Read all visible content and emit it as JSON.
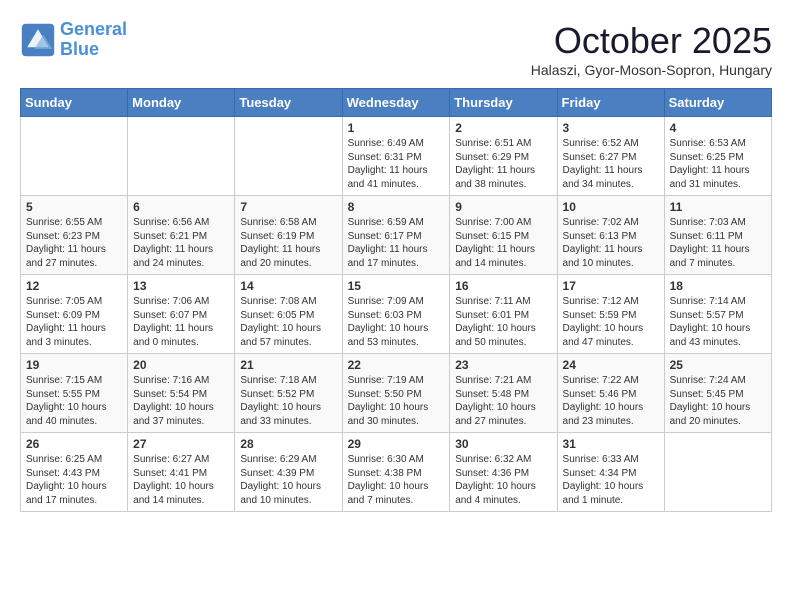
{
  "logo": {
    "line1": "General",
    "line2": "Blue"
  },
  "title": "October 2025",
  "subtitle": "Halaszi, Gyor-Moson-Sopron, Hungary",
  "days_of_week": [
    "Sunday",
    "Monday",
    "Tuesday",
    "Wednesday",
    "Thursday",
    "Friday",
    "Saturday"
  ],
  "weeks": [
    [
      {
        "day": "",
        "info": ""
      },
      {
        "day": "",
        "info": ""
      },
      {
        "day": "",
        "info": ""
      },
      {
        "day": "1",
        "info": "Sunrise: 6:49 AM\nSunset: 6:31 PM\nDaylight: 11 hours and 41 minutes."
      },
      {
        "day": "2",
        "info": "Sunrise: 6:51 AM\nSunset: 6:29 PM\nDaylight: 11 hours and 38 minutes."
      },
      {
        "day": "3",
        "info": "Sunrise: 6:52 AM\nSunset: 6:27 PM\nDaylight: 11 hours and 34 minutes."
      },
      {
        "day": "4",
        "info": "Sunrise: 6:53 AM\nSunset: 6:25 PM\nDaylight: 11 hours and 31 minutes."
      }
    ],
    [
      {
        "day": "5",
        "info": "Sunrise: 6:55 AM\nSunset: 6:23 PM\nDaylight: 11 hours and 27 minutes."
      },
      {
        "day": "6",
        "info": "Sunrise: 6:56 AM\nSunset: 6:21 PM\nDaylight: 11 hours and 24 minutes."
      },
      {
        "day": "7",
        "info": "Sunrise: 6:58 AM\nSunset: 6:19 PM\nDaylight: 11 hours and 20 minutes."
      },
      {
        "day": "8",
        "info": "Sunrise: 6:59 AM\nSunset: 6:17 PM\nDaylight: 11 hours and 17 minutes."
      },
      {
        "day": "9",
        "info": "Sunrise: 7:00 AM\nSunset: 6:15 PM\nDaylight: 11 hours and 14 minutes."
      },
      {
        "day": "10",
        "info": "Sunrise: 7:02 AM\nSunset: 6:13 PM\nDaylight: 11 hours and 10 minutes."
      },
      {
        "day": "11",
        "info": "Sunrise: 7:03 AM\nSunset: 6:11 PM\nDaylight: 11 hours and 7 minutes."
      }
    ],
    [
      {
        "day": "12",
        "info": "Sunrise: 7:05 AM\nSunset: 6:09 PM\nDaylight: 11 hours and 3 minutes."
      },
      {
        "day": "13",
        "info": "Sunrise: 7:06 AM\nSunset: 6:07 PM\nDaylight: 11 hours and 0 minutes."
      },
      {
        "day": "14",
        "info": "Sunrise: 7:08 AM\nSunset: 6:05 PM\nDaylight: 10 hours and 57 minutes."
      },
      {
        "day": "15",
        "info": "Sunrise: 7:09 AM\nSunset: 6:03 PM\nDaylight: 10 hours and 53 minutes."
      },
      {
        "day": "16",
        "info": "Sunrise: 7:11 AM\nSunset: 6:01 PM\nDaylight: 10 hours and 50 minutes."
      },
      {
        "day": "17",
        "info": "Sunrise: 7:12 AM\nSunset: 5:59 PM\nDaylight: 10 hours and 47 minutes."
      },
      {
        "day": "18",
        "info": "Sunrise: 7:14 AM\nSunset: 5:57 PM\nDaylight: 10 hours and 43 minutes."
      }
    ],
    [
      {
        "day": "19",
        "info": "Sunrise: 7:15 AM\nSunset: 5:55 PM\nDaylight: 10 hours and 40 minutes."
      },
      {
        "day": "20",
        "info": "Sunrise: 7:16 AM\nSunset: 5:54 PM\nDaylight: 10 hours and 37 minutes."
      },
      {
        "day": "21",
        "info": "Sunrise: 7:18 AM\nSunset: 5:52 PM\nDaylight: 10 hours and 33 minutes."
      },
      {
        "day": "22",
        "info": "Sunrise: 7:19 AM\nSunset: 5:50 PM\nDaylight: 10 hours and 30 minutes."
      },
      {
        "day": "23",
        "info": "Sunrise: 7:21 AM\nSunset: 5:48 PM\nDaylight: 10 hours and 27 minutes."
      },
      {
        "day": "24",
        "info": "Sunrise: 7:22 AM\nSunset: 5:46 PM\nDaylight: 10 hours and 23 minutes."
      },
      {
        "day": "25",
        "info": "Sunrise: 7:24 AM\nSunset: 5:45 PM\nDaylight: 10 hours and 20 minutes."
      }
    ],
    [
      {
        "day": "26",
        "info": "Sunrise: 6:25 AM\nSunset: 4:43 PM\nDaylight: 10 hours and 17 minutes."
      },
      {
        "day": "27",
        "info": "Sunrise: 6:27 AM\nSunset: 4:41 PM\nDaylight: 10 hours and 14 minutes."
      },
      {
        "day": "28",
        "info": "Sunrise: 6:29 AM\nSunset: 4:39 PM\nDaylight: 10 hours and 10 minutes."
      },
      {
        "day": "29",
        "info": "Sunrise: 6:30 AM\nSunset: 4:38 PM\nDaylight: 10 hours and 7 minutes."
      },
      {
        "day": "30",
        "info": "Sunrise: 6:32 AM\nSunset: 4:36 PM\nDaylight: 10 hours and 4 minutes."
      },
      {
        "day": "31",
        "info": "Sunrise: 6:33 AM\nSunset: 4:34 PM\nDaylight: 10 hours and 1 minute."
      },
      {
        "day": "",
        "info": ""
      }
    ]
  ]
}
